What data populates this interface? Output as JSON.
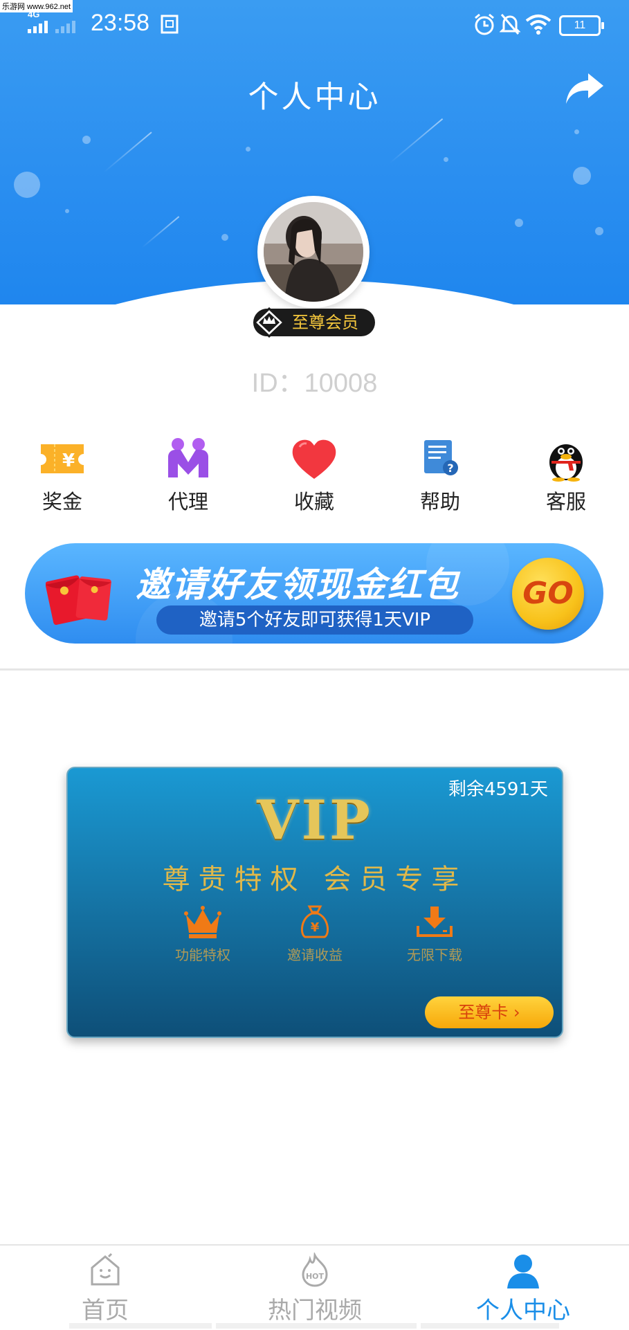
{
  "watermark": "乐游网 www.962.net",
  "status_bar": {
    "network": "4G",
    "time": "23:58",
    "battery": "11"
  },
  "header": {
    "title": "个人中心"
  },
  "profile": {
    "badge": "至尊会员",
    "id_text": "ID：10008"
  },
  "menu": [
    {
      "label": "奖金",
      "icon": "bonus-ticket-icon"
    },
    {
      "label": "代理",
      "icon": "agent-people-icon"
    },
    {
      "label": "收藏",
      "icon": "heart-icon"
    },
    {
      "label": "帮助",
      "icon": "help-document-icon"
    },
    {
      "label": "客服",
      "icon": "qq-penguin-icon"
    }
  ],
  "invite_banner": {
    "headline": "邀请好友领现金红包",
    "subline": "邀请5个好友即可获得1天VIP",
    "go_label": "GO"
  },
  "vip_card": {
    "remaining": "剩余4591天",
    "title": "VIP",
    "subtitle": "尊贵特权 会员专享",
    "features": [
      {
        "label": "功能特权",
        "icon": "crown-icon"
      },
      {
        "label": "邀请收益",
        "icon": "money-bag-icon"
      },
      {
        "label": "无限下载",
        "icon": "download-icon"
      }
    ],
    "button_label": "至尊卡 ›"
  },
  "bottom_nav": [
    {
      "label": "首页",
      "icon": "home-icon",
      "active": false
    },
    {
      "label": "热门视频",
      "icon": "hot-icon",
      "active": false
    },
    {
      "label": "个人中心",
      "icon": "person-icon",
      "active": true
    }
  ],
  "colors": {
    "primary_blue": "#2a8ef0",
    "gold": "#e6c65a",
    "active_nav": "#1a8ee8"
  }
}
